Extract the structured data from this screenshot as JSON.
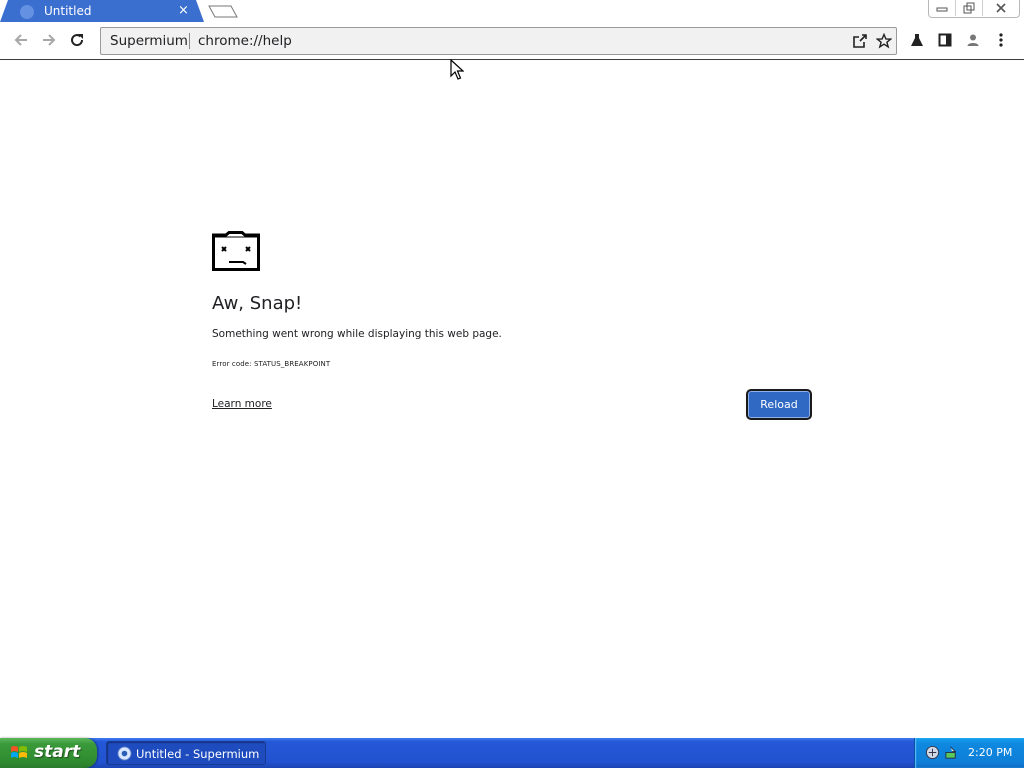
{
  "window": {
    "tab_title": "Untitled",
    "tab_close": "×",
    "controls": {
      "minimize": "minimize-icon",
      "restore": "restore-icon",
      "close": "close-icon"
    }
  },
  "toolbar": {
    "omnibox_chip": "Supermium",
    "url": "chrome://help",
    "icons": [
      "back-arrow-icon",
      "forward-arrow-icon",
      "reload-icon",
      "share-icon",
      "star-icon",
      "labs-flask-icon",
      "side-panel-icon",
      "profile-icon",
      "menu-kebab-icon"
    ]
  },
  "error_page": {
    "icon": "sad-tab-icon",
    "heading": "Aw, Snap!",
    "message": "Something went wrong while displaying this web page.",
    "error_code": "Error code: STATUS_BREAKPOINT",
    "learn_more": "Learn more",
    "reload_label": "Reload",
    "reload_color": "#2f69c4"
  },
  "taskbar": {
    "start_label": "start",
    "task_label": "Untitled - Supermium",
    "clock": "2:20 PM"
  }
}
